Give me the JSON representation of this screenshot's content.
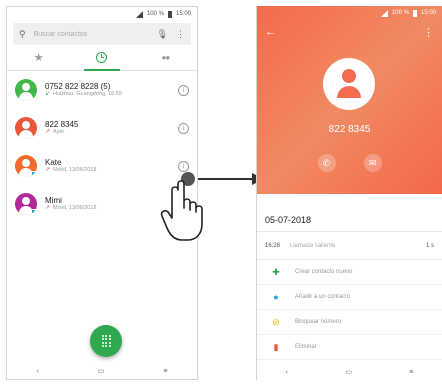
{
  "left_screen": {
    "status": {
      "battery": "100 %",
      "time": "15:00"
    },
    "search": {
      "placeholder": "Buscar contactos"
    },
    "tabs": [
      "favorites",
      "recents",
      "contacts"
    ],
    "calls": [
      {
        "name": "0752 822 8228 (5)",
        "meta": "Huizhou, Guangdong, 15:59",
        "direction": "in",
        "color": "#43b94b",
        "sim": false
      },
      {
        "name": "822 8345",
        "meta": "Ayer",
        "direction": "out",
        "color": "#e8573a",
        "sim": false
      },
      {
        "name": "Kate",
        "meta": "Móvil, 13/06/2018",
        "direction": "out",
        "color": "#f06a2e",
        "sim": true
      },
      {
        "name": "Mimi",
        "meta": "Móvil, 13/06/2018",
        "direction": "out",
        "color": "#b0289a",
        "sim": true
      }
    ],
    "nav": [
      "‹",
      "▭",
      "≡"
    ]
  },
  "right_screen": {
    "status": {
      "battery": "100 %",
      "time": "15:00"
    },
    "number": "822 8345",
    "date": "05-07-2018",
    "call_detail": {
      "time": "16:28",
      "type": "Llamada saliente",
      "duration": "1 s"
    },
    "actions": [
      {
        "label": "Crear contacto nuevo",
        "icon": "add-person-icon",
        "color": "#2fa84f"
      },
      {
        "label": "Añadir a un contacto",
        "icon": "person-icon",
        "color": "#1fa1d9"
      },
      {
        "label": "Bloquear número",
        "icon": "block-icon",
        "color": "#f5b800"
      },
      {
        "label": "Eliminar",
        "icon": "trash-icon",
        "color": "#e8573a"
      }
    ],
    "nav": [
      "‹",
      "▭",
      "≡"
    ]
  }
}
